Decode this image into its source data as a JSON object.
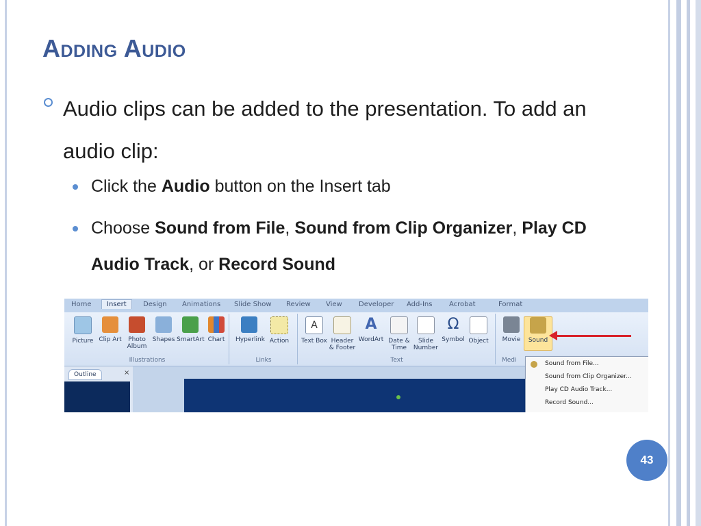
{
  "slide": {
    "title": "Adding Audio",
    "bullet": "Audio clips can be added to the presentation.  To add an audio clip:",
    "sub1": {
      "p1": "Click the ",
      "b1": "Audio",
      "p2": " button on the Insert tab"
    },
    "sub2": {
      "p1": "Choose ",
      "b1": "Sound from File",
      "p2": ", ",
      "b2": "Sound from Clip Organizer",
      "p3": ", ",
      "b3": "Play CD Audio Track",
      "p4": ", or ",
      "b4": "Record Sound"
    },
    "page_number": "43"
  },
  "screenshot": {
    "tabs": [
      "Home",
      "Insert",
      "Design",
      "Animations",
      "Slide Show",
      "Review",
      "View",
      "Developer",
      "Add-Ins",
      "Acrobat",
      "Format"
    ],
    "groups": {
      "illustrations": "Illustrations",
      "links": "Links",
      "text": "Text",
      "media": "Medi"
    },
    "commands": {
      "picture": "Picture",
      "clip_art": "Clip Art",
      "photo_album": "Photo Album",
      "shapes": "Shapes",
      "smartart": "SmartArt",
      "chart": "Chart",
      "hyperlink": "Hyperlink",
      "action": "Action",
      "text_box": "Text Box",
      "header_footer": "Header & Footer",
      "wordart": "WordArt",
      "date_time": "Date & Time",
      "slide_number": "Slide Number",
      "symbol": "Symbol",
      "object": "Object",
      "movie": "Movie",
      "sound": "Sound"
    },
    "outline_tab": "Outline",
    "pane_close": "×",
    "sound_menu": [
      "Sound from File...",
      "Sound from Clip Organizer...",
      "Play CD Audio Track...",
      "Record Sound..."
    ],
    "icons": {
      "text_box_glyph": "A",
      "wordart_glyph": "A",
      "symbol_glyph": "Ω"
    }
  }
}
